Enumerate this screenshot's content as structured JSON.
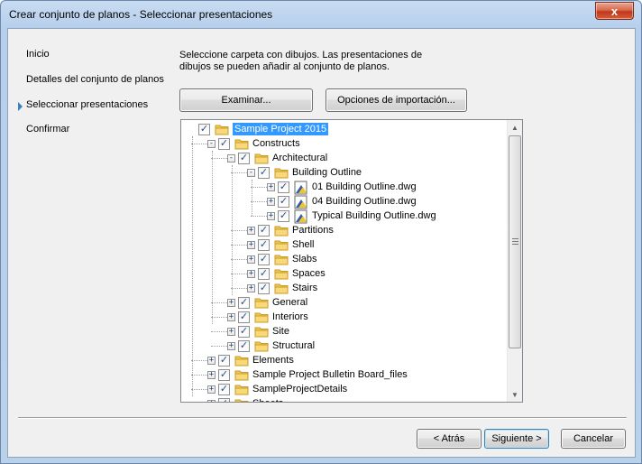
{
  "window": {
    "title": "Crear conjunto de planos - Seleccionar presentaciones",
    "close_glyph": "x"
  },
  "nav": {
    "items": [
      "Inicio",
      "Detalles del conjunto de planos",
      "Seleccionar presentaciones",
      "Confirmar"
    ],
    "current": "Seleccionar presentaciones"
  },
  "instructions": "Seleccione carpeta con dibujos. Las presentaciones de dibujos se pueden añadir al conjunto de planos.",
  "buttons": {
    "browse": "Examinar...",
    "import_options": "Opciones de importación...",
    "back": "< Atrás",
    "next": "Siguiente >",
    "cancel": "Cancelar"
  },
  "tree": {
    "nodes": [
      {
        "label": "Sample Project 2015",
        "level": 0,
        "icon": "folder-icon",
        "expander": "none",
        "selected": true
      },
      {
        "label": "Constructs",
        "level": 1,
        "icon": "folder-icon",
        "expander": "-"
      },
      {
        "label": "Architectural",
        "level": 2,
        "icon": "folder-icon",
        "expander": "-"
      },
      {
        "label": "Building Outline",
        "level": 3,
        "icon": "folder-icon",
        "expander": "-"
      },
      {
        "label": "01 Building Outline.dwg",
        "level": 4,
        "icon": "dwg-file-icon",
        "expander": "+"
      },
      {
        "label": "04 Building Outline.dwg",
        "level": 4,
        "icon": "dwg-file-icon",
        "expander": "+"
      },
      {
        "label": "Typical Building Outline.dwg",
        "level": 4,
        "icon": "dwg-file-icon",
        "expander": "+"
      },
      {
        "label": "Partitions",
        "level": 3,
        "icon": "folder-icon",
        "expander": "+"
      },
      {
        "label": "Shell",
        "level": 3,
        "icon": "folder-icon",
        "expander": "+"
      },
      {
        "label": "Slabs",
        "level": 3,
        "icon": "folder-icon",
        "expander": "+"
      },
      {
        "label": "Spaces",
        "level": 3,
        "icon": "folder-icon",
        "expander": "+"
      },
      {
        "label": "Stairs",
        "level": 3,
        "icon": "folder-icon",
        "expander": "+"
      },
      {
        "label": "General",
        "level": 2,
        "icon": "folder-icon",
        "expander": "+"
      },
      {
        "label": "Interiors",
        "level": 2,
        "icon": "folder-icon",
        "expander": "+"
      },
      {
        "label": "Site",
        "level": 2,
        "icon": "folder-icon",
        "expander": "+"
      },
      {
        "label": "Structural",
        "level": 2,
        "icon": "folder-icon",
        "expander": "+"
      },
      {
        "label": "Elements",
        "level": 1,
        "icon": "folder-icon",
        "expander": "+"
      },
      {
        "label": "Sample Project Bulletin Board_files",
        "level": 1,
        "icon": "folder-icon",
        "expander": "+"
      },
      {
        "label": "SampleProjectDetails",
        "level": 1,
        "icon": "folder-icon",
        "expander": "+"
      },
      {
        "label": "Sheets",
        "level": 1,
        "icon": "folder-icon",
        "expander": "+"
      }
    ],
    "checked_glyph": "✓"
  },
  "colors": {
    "selection": "#3399ff",
    "folder": "#f2c94c",
    "nav_arrow": "#3c7fc1"
  }
}
